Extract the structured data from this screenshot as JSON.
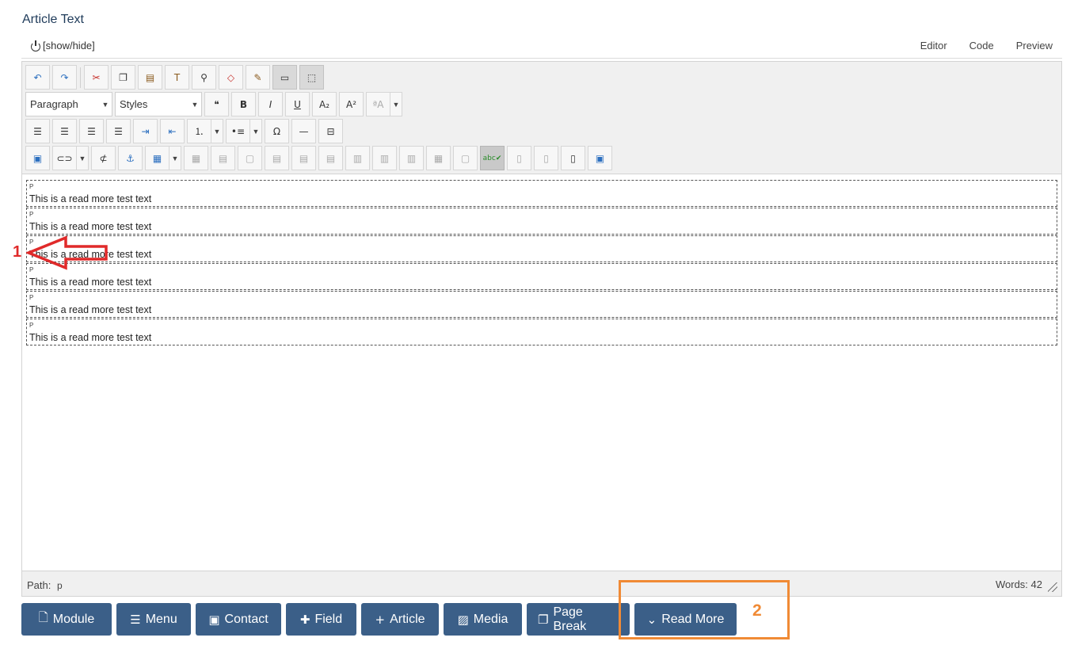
{
  "field_label": "Article Text",
  "header": {
    "toggle_label": "[show/hide]",
    "tabs": [
      "Editor",
      "Code",
      "Preview"
    ]
  },
  "toolbar": {
    "format_select": "Paragraph",
    "styles_select": "Styles",
    "row1_icons": [
      "undo-icon",
      "redo-icon",
      "cut-icon",
      "copy-icon",
      "paste-icon",
      "paste-text-icon",
      "find-icon",
      "remove-format-icon",
      "cleanup-icon",
      "visual-blocks-icon",
      "visual-aid-icon"
    ],
    "row2_icons": [
      "blockquote-icon",
      "bold-icon",
      "italic-icon",
      "underline-icon",
      "subscript-icon",
      "superscript-icon",
      "font-size-icon"
    ],
    "row3_icons": [
      "align-left-icon",
      "align-center-icon",
      "align-right-icon",
      "align-justify-icon",
      "indent-icon",
      "outdent-icon",
      "numbered-list-icon",
      "bullet-list-icon",
      "special-char-icon",
      "horizontal-rule-icon",
      "pagebreak-icon"
    ],
    "row4_icons": [
      "image-icon",
      "link-icon",
      "unlink-icon",
      "anchor-icon",
      "table-icon",
      "spellcheck-icon",
      "insert-file-icon",
      "delete-file-icon",
      "file-browse-icon",
      "image-manager-icon"
    ]
  },
  "content": {
    "paragraphs": [
      {
        "tag": "P",
        "text": "This is a read more test text"
      },
      {
        "tag": "P",
        "text": "This is a read more test text"
      },
      {
        "tag": "P",
        "text": "This is a read more test text"
      },
      {
        "tag": "P",
        "text": "This is a read more test text"
      },
      {
        "tag": "P",
        "text": "This is a read more test text"
      },
      {
        "tag": "P",
        "text": "This is a read more test text"
      }
    ]
  },
  "status": {
    "path_label": "Path:",
    "path_value": "p",
    "words": "Words: 42"
  },
  "buttons": {
    "module": "Module",
    "menu": "Menu",
    "contact": "Contact",
    "field": "Field",
    "article": "Article",
    "media": "Media",
    "page_break": "Page Break",
    "read_more": "Read More"
  },
  "annotations": {
    "marker1": "1",
    "marker2": "2"
  },
  "colors": {
    "button_bg": "#3b5f88",
    "annotation_red": "#e02a2a",
    "annotation_orange": "#f08a35"
  }
}
